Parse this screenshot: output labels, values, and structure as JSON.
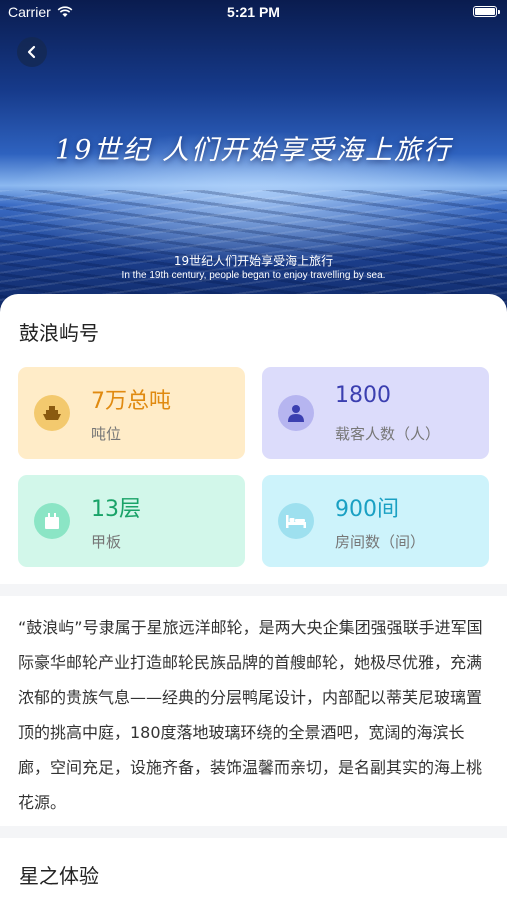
{
  "status_bar": {
    "carrier": "Carrier",
    "time": "5:21 PM"
  },
  "hero": {
    "title": "19世纪 人们开始享受海上旅行",
    "subtitle_cn": "19世纪人们开始享受海上旅行",
    "subtitle_en": "In the 19th century, people began to enjoy travelling by sea."
  },
  "ship": {
    "name": "鼓浪屿号"
  },
  "stats": [
    {
      "value": "7万总吨",
      "label": "吨位",
      "icon": "ship-icon"
    },
    {
      "value": "1800",
      "label": "载客人数（人）",
      "icon": "passenger-icon"
    },
    {
      "value": "13层",
      "label": "甲板",
      "icon": "deck-icon"
    },
    {
      "value": "900间",
      "label": "房间数（间）",
      "icon": "bed-icon"
    }
  ],
  "description": "“鼓浪屿”号隶属于星旅远洋邮轮，是两大央企集团强强联手进军国际豪华邮轮产业打造邮轮民族品牌的首艘邮轮，她极尽优雅，充满浓郁的贵族气息——经典的分层鸭尾设计，内部配以蒂芙尼玻璃置顶的挑高中庭，180度落地玻璃环绕的全景酒吧，宽阔的海滨长廊，空间充足，设施齐备，装饰温馨而亲切，是名副其实的海上桃花源。",
  "section2": {
    "title": "星之体验"
  }
}
